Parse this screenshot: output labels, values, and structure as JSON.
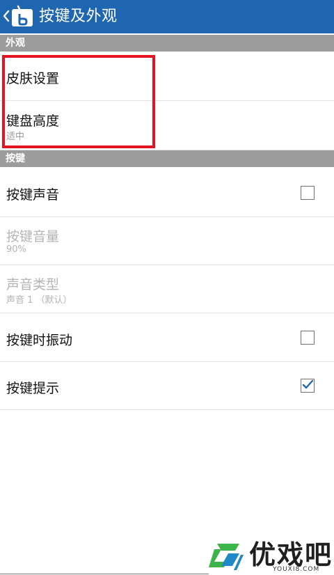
{
  "app_bar": {
    "title": "按键及外观",
    "back_icon": "chevron-left-icon",
    "app_icon": "keyboard-app-icon",
    "background_color": "#1f66b1"
  },
  "sections": {
    "appearance": {
      "header": "外观",
      "items": [
        {
          "title": "皮肤设置"
        },
        {
          "title": "键盘高度",
          "summary": "适中"
        }
      ]
    },
    "keys": {
      "header": "按键",
      "items": [
        {
          "title": "按键声音",
          "checked": false
        },
        {
          "title": "按键音量",
          "summary": "90%",
          "enabled": false
        },
        {
          "title": "声音类型",
          "summary": "声音 1 （默认）",
          "enabled": false
        },
        {
          "title": "按键时振动",
          "checked": false
        },
        {
          "title": "按键提示",
          "checked": true
        }
      ]
    }
  },
  "annotation": {
    "highlight_color": "#e3141f"
  },
  "watermark": {
    "brand": "优戏吧",
    "domain": "YOUXI8.COM"
  }
}
